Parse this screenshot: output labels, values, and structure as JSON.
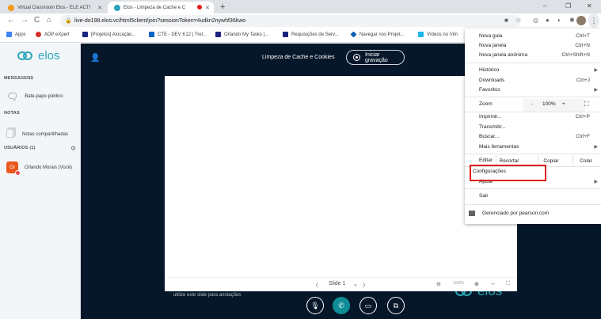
{
  "browser": {
    "tabs": [
      {
        "title": "Virtual Classroom Elos - ELE ACTI",
        "active": false
      },
      {
        "title": "Elos - Limpeza de Cache e C",
        "active": true
      }
    ],
    "new_tab": "+",
    "window_controls": [
      "–",
      "❐",
      "✕"
    ],
    "url": "live-do198.elos.vc/html5client/join?sessionToken=4udkn2nywhf36kwo",
    "nav": {
      "back": "←",
      "forward": "→",
      "reload": "C",
      "home": "⌂"
    },
    "bookmarks": [
      {
        "label": "Apps",
        "color": "#4285f4"
      },
      {
        "label": "ADP eXpert",
        "color": "#d93025"
      },
      {
        "label": "[Projetos] Alocação...",
        "color": "#1a237e"
      },
      {
        "label": "CTE - DEV K12 | Trel...",
        "color": "#0b64c8"
      },
      {
        "label": "Orlando My Tasks |...",
        "color": "#1a237e"
      },
      {
        "label": "Requisições de Serv...",
        "color": "#1a237e"
      },
      {
        "label": "Navegar nos Projet...",
        "color": "#0b5fb3"
      },
      {
        "label": "Vídeos no Vim",
        "color": "#1ab7ea"
      }
    ]
  },
  "sidebar": {
    "logo": "elos",
    "sections": {
      "messages": "MENSAGENS",
      "notes": "NOTAS",
      "users": "USUÁRIOS (1)"
    },
    "public_chat": "Bate-papo público",
    "shared_notes": "Notas compartilhadas",
    "user_initials": "Or",
    "user_name": "Orlando Morais (Você)",
    "fab": "+"
  },
  "main": {
    "title": "Limpeza de Cache e Cookies",
    "record_label": "Iniciar gravação",
    "slide_hint": "utilize este slide para anotações",
    "slide_logo": "elos",
    "slide_label": "Slide 1",
    "zoom_label": "100%"
  },
  "menu": {
    "items": {
      "new_tab": {
        "label": "Nova guia",
        "shortcut": "Ctrl+T"
      },
      "new_window": {
        "label": "Nova janela",
        "shortcut": "Ctrl+N"
      },
      "incognito": {
        "label": "Nova janela anônima",
        "shortcut": "Ctrl+Shift+N"
      },
      "history": {
        "label": "Histórico"
      },
      "downloads": {
        "label": "Downloads",
        "shortcut": "Ctrl+J"
      },
      "favorites": {
        "label": "Favoritos"
      },
      "print": {
        "label": "Imprimir...",
        "shortcut": "Ctrl+P"
      },
      "cast": {
        "label": "Transmitir..."
      },
      "find": {
        "label": "Buscar...",
        "shortcut": "Ctrl+F"
      },
      "more_tools": {
        "label": "Mais ferramentas"
      },
      "settings": {
        "label": "Configurações"
      },
      "help": {
        "label": "Ajuda"
      },
      "exit": {
        "label": "Sair"
      }
    },
    "zoom": {
      "label": "Zoom",
      "minus": "-",
      "value": "100%",
      "plus": "+"
    },
    "edit": {
      "label": "Editar",
      "cut": "Recortar",
      "copy": "Copiar",
      "paste": "Colar"
    },
    "managed": "Gerenciado por pearson.com"
  },
  "colors": {
    "accent": "#2aa6b9",
    "highlight": "#e21d1d",
    "meeting_bg": "#06172a"
  }
}
